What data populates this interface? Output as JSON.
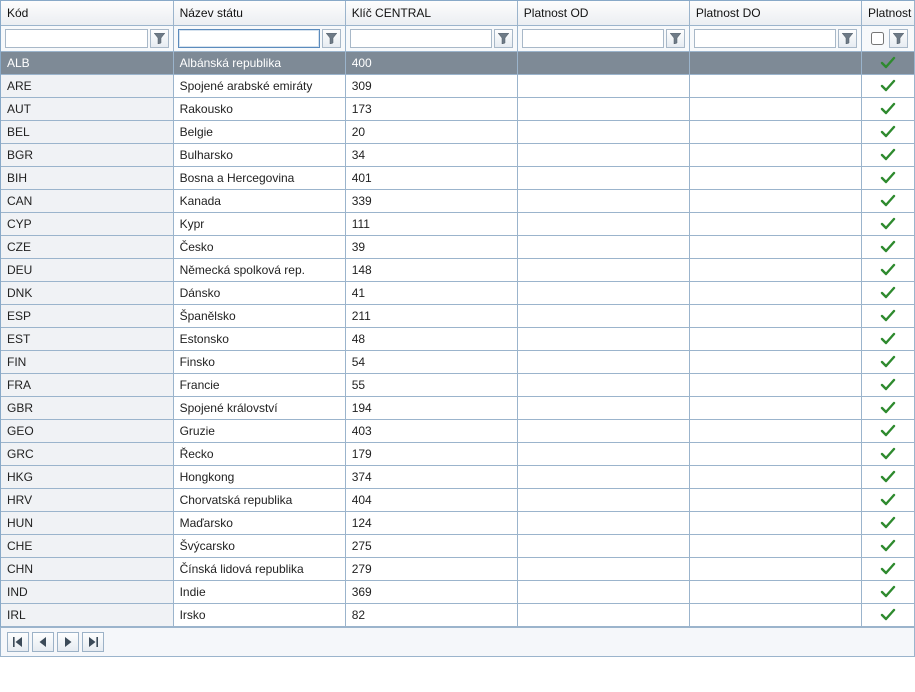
{
  "columns": {
    "kod": {
      "header": "Kód"
    },
    "nazev": {
      "header": "Název státu"
    },
    "klic": {
      "header": "Klíč CENTRAL"
    },
    "od": {
      "header": "Platnost OD"
    },
    "do": {
      "header": "Platnost DO"
    },
    "plat": {
      "header": "Platnost"
    }
  },
  "filters": {
    "kod": "",
    "nazev": "",
    "klic": "",
    "od": "",
    "do": "",
    "plat_checked": false
  },
  "selected_index": 0,
  "rows": [
    {
      "kod": "ALB",
      "nazev": "Albánská republika",
      "klic": "400",
      "od": "",
      "do": "",
      "plat": true
    },
    {
      "kod": "ARE",
      "nazev": "Spojené arabské emiráty",
      "klic": "309",
      "od": "",
      "do": "",
      "plat": true
    },
    {
      "kod": "AUT",
      "nazev": "Rakousko",
      "klic": "173",
      "od": "",
      "do": "",
      "plat": true
    },
    {
      "kod": "BEL",
      "nazev": "Belgie",
      "klic": "20",
      "od": "",
      "do": "",
      "plat": true
    },
    {
      "kod": "BGR",
      "nazev": "Bulharsko",
      "klic": "34",
      "od": "",
      "do": "",
      "plat": true
    },
    {
      "kod": "BIH",
      "nazev": "Bosna a Hercegovina",
      "klic": "401",
      "od": "",
      "do": "",
      "plat": true
    },
    {
      "kod": "CAN",
      "nazev": "Kanada",
      "klic": "339",
      "od": "",
      "do": "",
      "plat": true
    },
    {
      "kod": "CYP",
      "nazev": "Kypr",
      "klic": "111",
      "od": "",
      "do": "",
      "plat": true
    },
    {
      "kod": "CZE",
      "nazev": "Česko",
      "klic": "39",
      "od": "",
      "do": "",
      "plat": true
    },
    {
      "kod": "DEU",
      "nazev": "Německá spolková rep.",
      "klic": "148",
      "od": "",
      "do": "",
      "plat": true
    },
    {
      "kod": "DNK",
      "nazev": "Dánsko",
      "klic": "41",
      "od": "",
      "do": "",
      "plat": true
    },
    {
      "kod": "ESP",
      "nazev": "Španělsko",
      "klic": "211",
      "od": "",
      "do": "",
      "plat": true
    },
    {
      "kod": "EST",
      "nazev": "Estonsko",
      "klic": "48",
      "od": "",
      "do": "",
      "plat": true
    },
    {
      "kod": "FIN",
      "nazev": "Finsko",
      "klic": "54",
      "od": "",
      "do": "",
      "plat": true
    },
    {
      "kod": "FRA",
      "nazev": "Francie",
      "klic": "55",
      "od": "",
      "do": "",
      "plat": true
    },
    {
      "kod": "GBR",
      "nazev": "Spojené království",
      "klic": "194",
      "od": "",
      "do": "",
      "plat": true
    },
    {
      "kod": "GEO",
      "nazev": "Gruzie",
      "klic": "403",
      "od": "",
      "do": "",
      "plat": true
    },
    {
      "kod": "GRC",
      "nazev": "Řecko",
      "klic": "179",
      "od": "",
      "do": "",
      "plat": true
    },
    {
      "kod": "HKG",
      "nazev": "Hongkong",
      "klic": "374",
      "od": "",
      "do": "",
      "plat": true
    },
    {
      "kod": "HRV",
      "nazev": "Chorvatská republika",
      "klic": "404",
      "od": "",
      "do": "",
      "plat": true
    },
    {
      "kod": "HUN",
      "nazev": "Maďarsko",
      "klic": "124",
      "od": "",
      "do": "",
      "plat": true
    },
    {
      "kod": "CHE",
      "nazev": "Švýcarsko",
      "klic": "275",
      "od": "",
      "do": "",
      "plat": true
    },
    {
      "kod": "CHN",
      "nazev": "Čínská lidová republika",
      "klic": "279",
      "od": "",
      "do": "",
      "plat": true
    },
    {
      "kod": "IND",
      "nazev": "Indie",
      "klic": "369",
      "od": "",
      "do": "",
      "plat": true
    },
    {
      "kod": "IRL",
      "nazev": "Irsko",
      "klic": "82",
      "od": "",
      "do": "",
      "plat": true
    }
  ],
  "nav": {
    "first": "first-record",
    "prev": "previous-record",
    "next": "next-record",
    "last": "last-record"
  }
}
